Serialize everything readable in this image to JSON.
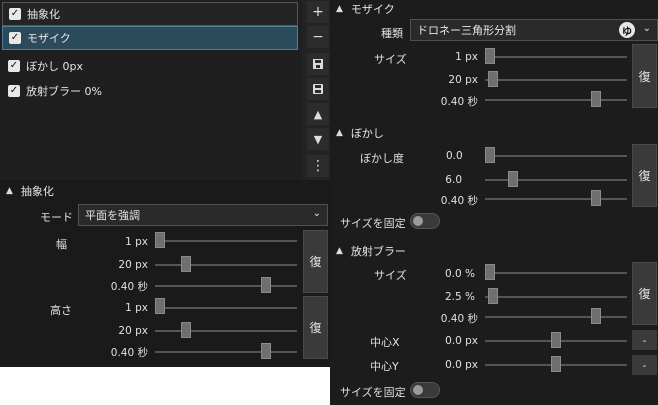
{
  "effects_list": {
    "items": [
      {
        "label": "抽象化",
        "checked": true
      },
      {
        "label": "モザイク",
        "checked": true
      },
      {
        "label": "ぼかし 0px",
        "checked": true
      },
      {
        "label": "放射ブラー 0%",
        "checked": true
      }
    ]
  },
  "toolbar": {
    "add": "+",
    "remove": "−",
    "up": "▲",
    "down": "▼",
    "more": "⋮",
    "icons": [
      "plus-icon",
      "minus-icon",
      "save-copy-icon",
      "save-icon",
      "arrow-up-icon",
      "arrow-down-icon",
      "more-icon"
    ]
  },
  "abstract": {
    "title": "抽象化",
    "mode_label": "モード",
    "mode_value": "平面を強調",
    "width_label": "幅",
    "width": {
      "v1": "1 px",
      "v2": "20 px",
      "v3": "0.40 秒",
      "s1": 0.0,
      "s2": 0.2,
      "s3": 0.8
    },
    "height_label": "高さ",
    "height": {
      "v1": "1 px",
      "v2": "20 px",
      "v3": "0.40 秒",
      "s1": 0.0,
      "s2": 0.2,
      "s3": 0.8
    },
    "reset": "復"
  },
  "mosaic": {
    "title": "モザイク",
    "type_label": "種類",
    "type_value": "ドロネー三角形分割",
    "size_label": "サイズ",
    "v1": "1 px",
    "v2": "20 px",
    "v3": "0.40 秒",
    "s1": 0.0,
    "s2": 0.02,
    "s3": 0.8,
    "reset": "復"
  },
  "blur": {
    "title": "ぼかし",
    "degree_label": "ぼかし度",
    "v1": "0.0",
    "v2": "6.0",
    "v3": "0.40 秒",
    "s1": 0.0,
    "s2": 0.1,
    "s3": 0.8,
    "reset": "復",
    "fix_size_label": "サイズを固定",
    "fix_size_on": false
  },
  "radial": {
    "title": "放射ブラー",
    "size_label": "サイズ",
    "v1": "0.0 %",
    "v2": "2.5 %",
    "v3": "0.40 秒",
    "s1": 0.0,
    "s2": 0.02,
    "s3": 0.8,
    "reset": "復",
    "cx_label": "中心X",
    "cx_value": "0.0 px",
    "cx_pos": 0.5,
    "cy_label": "中心Y",
    "cy_value": "0.0 px",
    "cy_pos": 0.5,
    "dash": "-",
    "fix_size_label": "サイズを固定",
    "fix_size_on": false
  }
}
